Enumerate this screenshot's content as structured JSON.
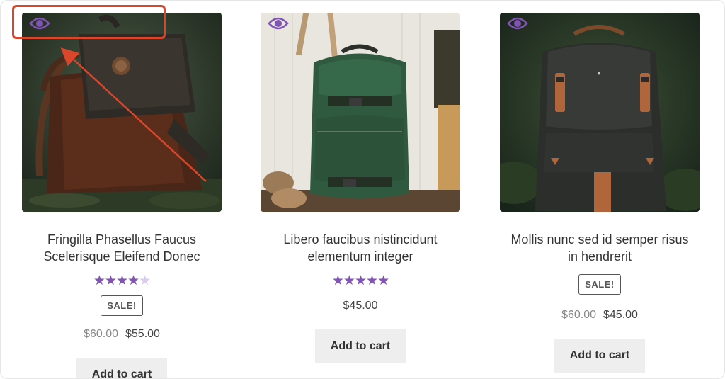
{
  "products": [
    {
      "title": "Fringilla Phasellus Faucus Scelerisque Eleifend Donec",
      "rating": 4,
      "rating_max": 5,
      "badge": "SALE!",
      "old_price": "$60.00",
      "price": "$55.00",
      "button_label": "Add to cart"
    },
    {
      "title": "Libero faucibus nistincidunt elementum integer",
      "rating": 5,
      "rating_max": 5,
      "price": "$45.00",
      "button_label": "Add to cart"
    },
    {
      "title": "Mollis nunc sed id semper risus in hendrerit",
      "badge": "SALE!",
      "old_price": "$60.00",
      "price": "$45.00",
      "button_label": "Add to cart"
    }
  ],
  "colors": {
    "accent": "#7f54b3",
    "annotation": "#d9462b"
  },
  "icons": {
    "quick_view": "eye-icon"
  }
}
